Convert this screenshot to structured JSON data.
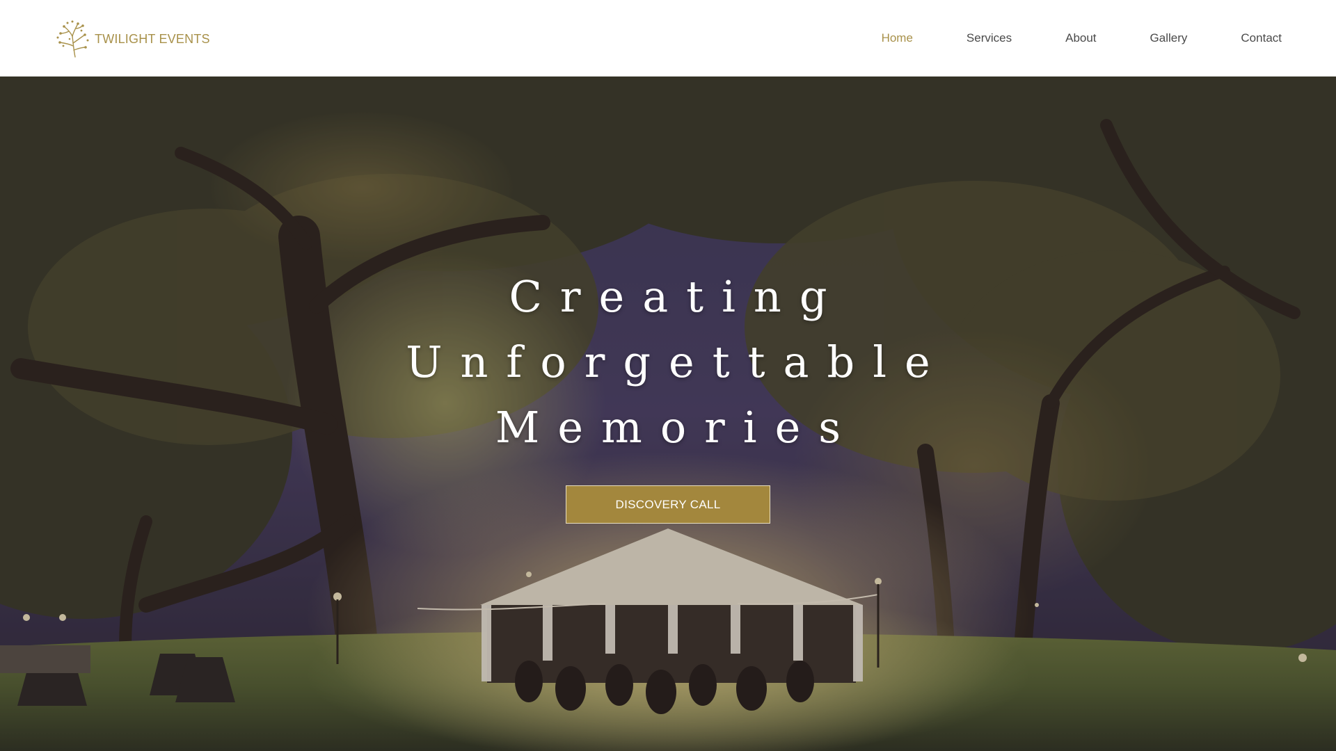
{
  "brand": {
    "name": "TWILIGHT EVENTS",
    "logo_icon": "branch-sprig-icon",
    "color": "#a8914a"
  },
  "nav": {
    "items": [
      {
        "label": "Home",
        "active": true
      },
      {
        "label": "Services",
        "active": false
      },
      {
        "label": "About",
        "active": false
      },
      {
        "label": "Gallery",
        "active": false
      },
      {
        "label": "Contact",
        "active": false
      }
    ]
  },
  "hero": {
    "title_lines": [
      "Creating",
      "Unforgettable",
      "Memories"
    ],
    "cta_label": "DISCOVERY CALL",
    "cta_color": "#a3873d"
  }
}
